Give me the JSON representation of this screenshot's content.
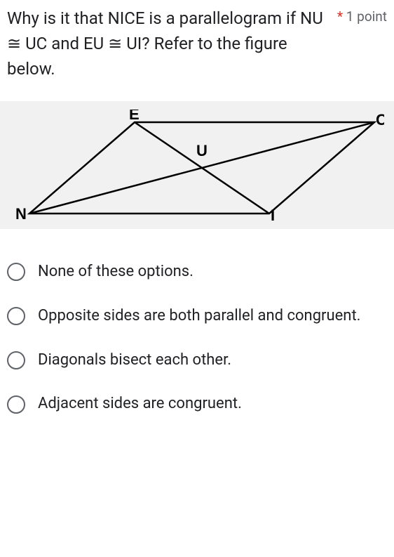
{
  "question": {
    "text": "Why is it that NICE is a parallelogram if NU ≅ UC and EU ≅ UI?  Refer to the figure below.",
    "required_marker": "*",
    "points_label": "1 point"
  },
  "figure": {
    "labels": {
      "E": "E",
      "C": "C",
      "U": "U",
      "N": "N",
      "I": "I"
    }
  },
  "options": [
    {
      "label": "None of these options."
    },
    {
      "label": "Opposite sides are both parallel and congruent."
    },
    {
      "label": "Diagonals bisect each other."
    },
    {
      "label": "Adjacent sides are congruent."
    }
  ]
}
